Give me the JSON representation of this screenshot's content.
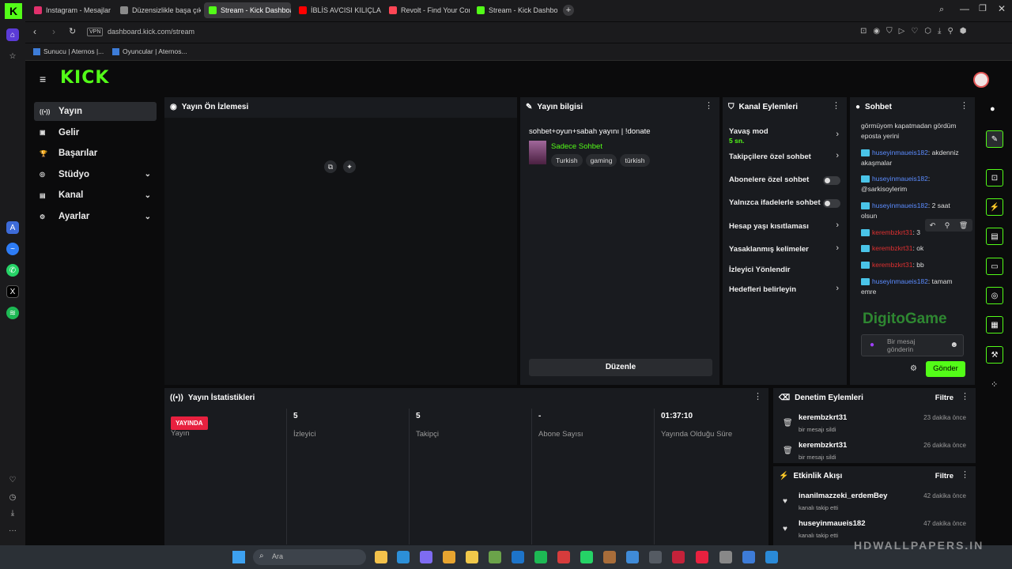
{
  "browser": {
    "tabs": [
      {
        "label": "Instagram - Mesajlar",
        "color": "#e1306c",
        "active": false
      },
      {
        "label": "Düzensizlikle başa çıkma",
        "color": "#8a8a8a",
        "active": false
      },
      {
        "label": "Stream - Kick Dashboard",
        "color": "#53fc18",
        "active": true
      },
      {
        "label": "İBLİS AVCISI KILIÇLARI Yap",
        "color": "#ff0000",
        "active": false
      },
      {
        "label": "Revolt - Find Your Commu",
        "color": "#ff4655",
        "active": false
      },
      {
        "label": "Stream - Kick Dashboard",
        "color": "#53fc18",
        "active": false
      }
    ],
    "url": "dashboard.kick.com/stream",
    "vpn_label": "VPN",
    "bookmarks": [
      "Sunucu | Aternos |...",
      "Oyuncular | Aternos..."
    ]
  },
  "sidebar": {
    "items": [
      {
        "label": "Yayın",
        "icon": "broadcast-icon",
        "glyph": "((•))",
        "active": true,
        "expandable": false
      },
      {
        "label": "Gelir",
        "icon": "wallet-icon",
        "glyph": "▣",
        "active": false,
        "expandable": false
      },
      {
        "label": "Başarılar",
        "icon": "trophy-icon",
        "glyph": "🏆",
        "active": false,
        "expandable": false
      },
      {
        "label": "Stüdyo",
        "icon": "studio-icon",
        "glyph": "◎",
        "active": false,
        "expandable": true
      },
      {
        "label": "Kanal",
        "icon": "channel-icon",
        "glyph": "▤",
        "active": false,
        "expandable": true
      },
      {
        "label": "Ayarlar",
        "icon": "settings-icon",
        "glyph": "⚙",
        "active": false,
        "expandable": true
      }
    ]
  },
  "preview": {
    "title": "Yayın Ön İzlemesi"
  },
  "stream_info": {
    "title": "Yayın bilgisi",
    "stream_title": "sohbet+oyun+sabah yayını | !donate",
    "category": "Sadece Sohbet",
    "tags": [
      "Turkish",
      "gaming",
      "türkish"
    ],
    "edit_label": "Düzenle"
  },
  "channel_actions": {
    "title": "Kanal Eylemleri",
    "slow_mode_label": "Yavaş mod",
    "slow_mode_value": "5 sn.",
    "items": [
      {
        "label": "Takipçilere özel sohbet",
        "control": "arrow"
      },
      {
        "label": "Abonelere özel sohbet",
        "control": "toggle"
      },
      {
        "label": "Yalnızca ifadelerle sohbet",
        "control": "toggle"
      },
      {
        "label": "Hesap yaşı kısıtlaması",
        "control": "arrow"
      },
      {
        "label": "Yasaklanmış kelimeler",
        "control": "arrow"
      },
      {
        "label": "İzleyici Yönlendir",
        "control": "none"
      },
      {
        "label": "Hedefleri belirleyin",
        "control": "arrow"
      }
    ]
  },
  "chat": {
    "title": "Sohbet",
    "messages": [
      {
        "user": "",
        "text": "görmüyom kapatmadan gördüm eposta yerini",
        "color": "blue"
      },
      {
        "user": "huseyinmaueis182",
        "text": ": akdenniz akaşmalar",
        "color": "blue"
      },
      {
        "user": "huseyinmaueis182",
        "text": ": @sarkisoylerim",
        "color": "blue"
      },
      {
        "user": "huseyinmaueis182",
        "text": ": 2 saat olsun",
        "color": "blue"
      },
      {
        "user": "kerembzkrt31",
        "text": ": 3",
        "color": "red"
      },
      {
        "user": "kerembzkrt31",
        "text": ": ok",
        "color": "red"
      },
      {
        "user": "kerembzkrt31",
        "text": ": bb",
        "color": "red"
      },
      {
        "user": "huseyinmaueis182",
        "text": ": tamam emre",
        "color": "blue"
      }
    ],
    "input_placeholder": "Bir mesaj gönderin",
    "send_label": "Gönder",
    "watermark": "DigitoGame"
  },
  "stats": {
    "title": "Yayın İstatistikleri",
    "live_badge": "YAYINDA",
    "items": [
      {
        "value": "",
        "label": "Yayın"
      },
      {
        "value": "5",
        "label": "İzleyici"
      },
      {
        "value": "5",
        "label": "Takipçi"
      },
      {
        "value": "-",
        "label": "Abone Sayısı"
      },
      {
        "value": "01:37:10",
        "label": "Yayında Olduğu Süre"
      }
    ]
  },
  "moderation": {
    "title": "Denetim Eylemleri",
    "filter_label": "Filtre",
    "items": [
      {
        "name": "kerembzkrt31",
        "sub": "bir mesajı sildi",
        "time": "23 dakika önce"
      },
      {
        "name": "kerembzkrt31",
        "sub": "bir mesajı sildi",
        "time": "26 dakika önce"
      }
    ]
  },
  "activity": {
    "title": "Etkinlik Akışı",
    "filter_label": "Filtre",
    "items": [
      {
        "name": "inanilmazzeki_erdemBey",
        "sub": "kanalı takip etti",
        "time": "42 dakika önce"
      },
      {
        "name": "huseyinmaueis182",
        "sub": "kanalı takip etti",
        "time": "47 dakika önce"
      }
    ]
  },
  "taskbar": {
    "search_placeholder": "Ara",
    "watermark": "HDWALLPAPERS.IN"
  },
  "colors": {
    "accent": "#53fc18",
    "panel": "#191b1f",
    "bg": "#0b0b0c",
    "live": "#e8213f"
  }
}
